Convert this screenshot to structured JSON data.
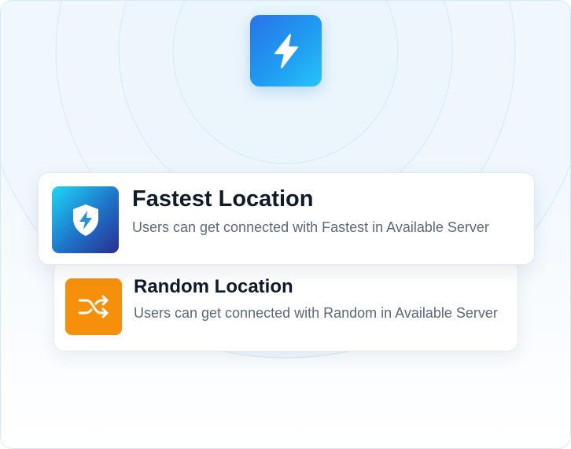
{
  "hero": {
    "icon": "lightning-bolt-icon",
    "colors": {
      "start": "#2a73e6",
      "end": "#27c4f7"
    }
  },
  "options": [
    {
      "title": "Fastest Location",
      "description": "Users can get connected with Fastest in Available Server",
      "icon": "shield-lightning-icon",
      "color": "#1e72c8"
    },
    {
      "title": "Random Location",
      "description": "Users can get connected with Random in Available Server",
      "icon": "shuffle-icon",
      "color": "#f6900b"
    }
  ]
}
